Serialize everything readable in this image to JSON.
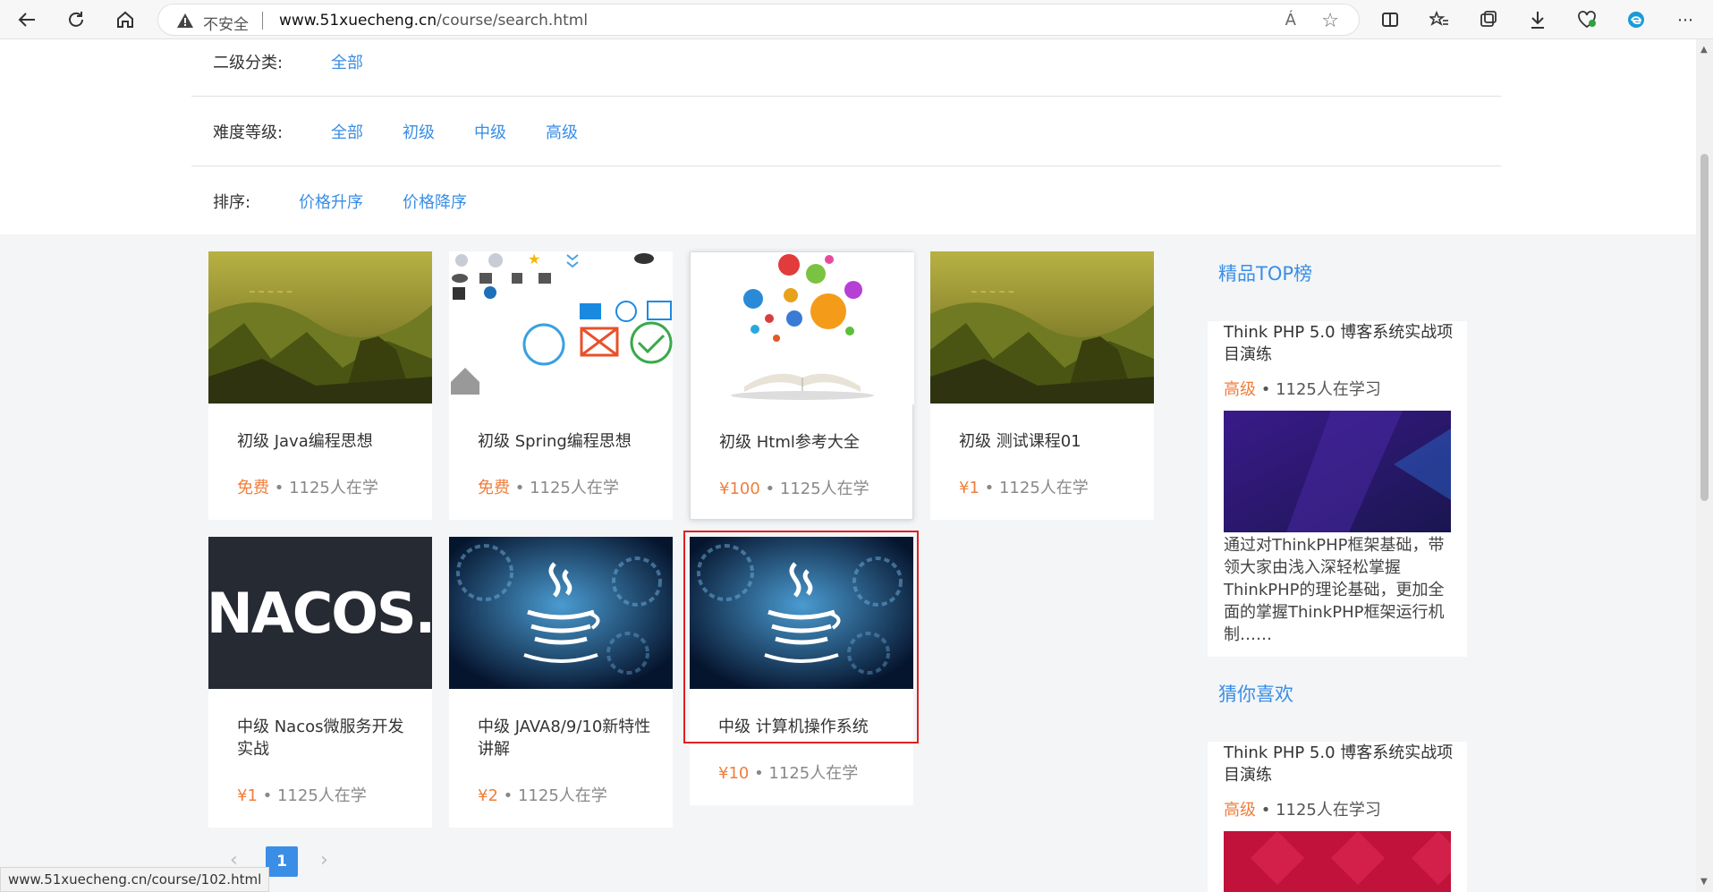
{
  "browser": {
    "insecure_label": "不安全",
    "url_host": "www.51xuecheng.cn",
    "url_path": "/course/search.html",
    "read_aloud_label": "Á"
  },
  "filters": {
    "secondary_category": {
      "label": "二级分类:",
      "options": [
        "全部"
      ]
    },
    "difficulty": {
      "label": "难度等级:",
      "options": [
        "全部",
        "初级",
        "中级",
        "高级"
      ]
    },
    "sort": {
      "label": "排序:",
      "options": [
        "价格升序",
        "价格降序"
      ]
    }
  },
  "courses": [
    {
      "title": "初级 Java编程思想",
      "price": "免费",
      "learners": "1125人在学",
      "image": "mountain-landscape"
    },
    {
      "title": "初级 Spring编程思想",
      "price": "免费",
      "learners": "1125人在学",
      "image": "icon-grid"
    },
    {
      "title": "初级 Html参考大全",
      "price": "¥100",
      "learners": "1125人在学",
      "image": "book-bubbles"
    },
    {
      "title": "初级 测试课程01",
      "price": "¥1",
      "learners": "1125人在学",
      "image": "mountain-landscape"
    },
    {
      "title": "中级 Nacos微服务开发实战",
      "price": "¥1",
      "learners": "1125人在学",
      "image": "nacos-logo"
    },
    {
      "title": "中级 JAVA8/9/10新特性讲解",
      "price": "¥2",
      "learners": "1125人在学",
      "image": "java-gears"
    },
    {
      "title": "中级 计算机操作系统",
      "price": "¥10",
      "learners": "1125人在学",
      "image": "java-gears"
    }
  ],
  "nacos_text": "NACOS.",
  "meta_separator": " • ",
  "sidebar": {
    "top_title": "精品TOP榜",
    "top_item": {
      "title": "Think PHP 5.0 博客系统实战项目演练",
      "level": "高级",
      "learners": "1125人在学习",
      "desc": "通过对ThinkPHP框架基础，带领大家由浅入深轻松掌握ThinkPHP的理论基础，更加全面的掌握ThinkPHP框架运行机制……"
    },
    "guess_title": "猜你喜欢",
    "guess_item": {
      "title": "Think PHP 5.0 博客系统实战项目演练",
      "level": "高级",
      "learners": "1125人在学习"
    }
  },
  "pagination": {
    "current": "1",
    "prev": "‹",
    "next": "›"
  },
  "status_bar_url": "www.51xuecheng.cn/course/102.html",
  "colors": {
    "accent": "#3a8ee6",
    "price": "#f07e3c",
    "highlight": "#e02020"
  }
}
